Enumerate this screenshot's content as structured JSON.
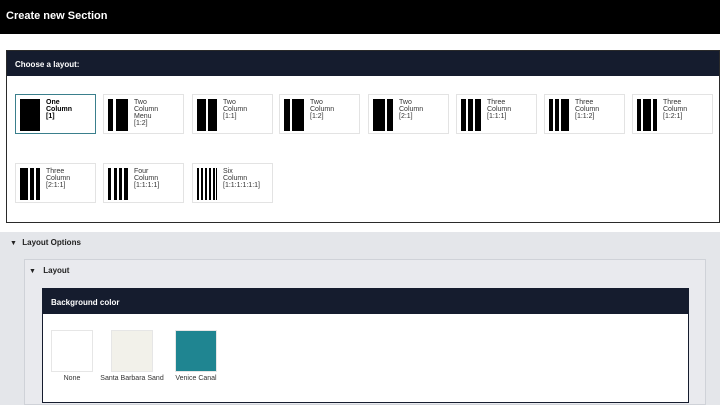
{
  "dialog": {
    "title": "Create new Section"
  },
  "layout_panel": {
    "header": "Choose a layout:",
    "layouts": [
      {
        "label": "One\nColumn\n[1]",
        "selected": true
      },
      {
        "label": "Two\nColumn\nMenu\n[1:2]",
        "selected": false
      },
      {
        "label": "Two\nColumn\n[1:1]",
        "selected": false
      },
      {
        "label": "Two\nColumn\n[1:2]",
        "selected": false
      },
      {
        "label": "Two\nColumn\n[2:1]",
        "selected": false
      },
      {
        "label": "Three\nColumn\n[1:1:1]",
        "selected": false
      },
      {
        "label": "Three\nColumn\n[1:1:2]",
        "selected": false
      },
      {
        "label": "Three\nColumn\n[1:2:1]",
        "selected": false
      },
      {
        "label": "Three\nColumn\n[2:1:1]",
        "selected": false
      },
      {
        "label": "Four\nColumn\n[1:1:1:1]",
        "selected": false
      },
      {
        "label": "Six\nColumn\n[1:1:1:1:1:1]",
        "selected": false
      }
    ]
  },
  "layout_options": {
    "label": "Layout Options",
    "layout": {
      "label": "Layout",
      "background": {
        "header": "Background color",
        "swatches": [
          {
            "name": "None",
            "color": "#ffffff"
          },
          {
            "name": "Santa Barbara Sand",
            "color": "#f2f1ea"
          },
          {
            "name": "Venice Canal",
            "color": "#1f8591"
          }
        ]
      }
    }
  },
  "colors": {
    "titlebar": "#000000",
    "header_bg": "#151c2e",
    "selected_border": "#3a7f8c"
  }
}
